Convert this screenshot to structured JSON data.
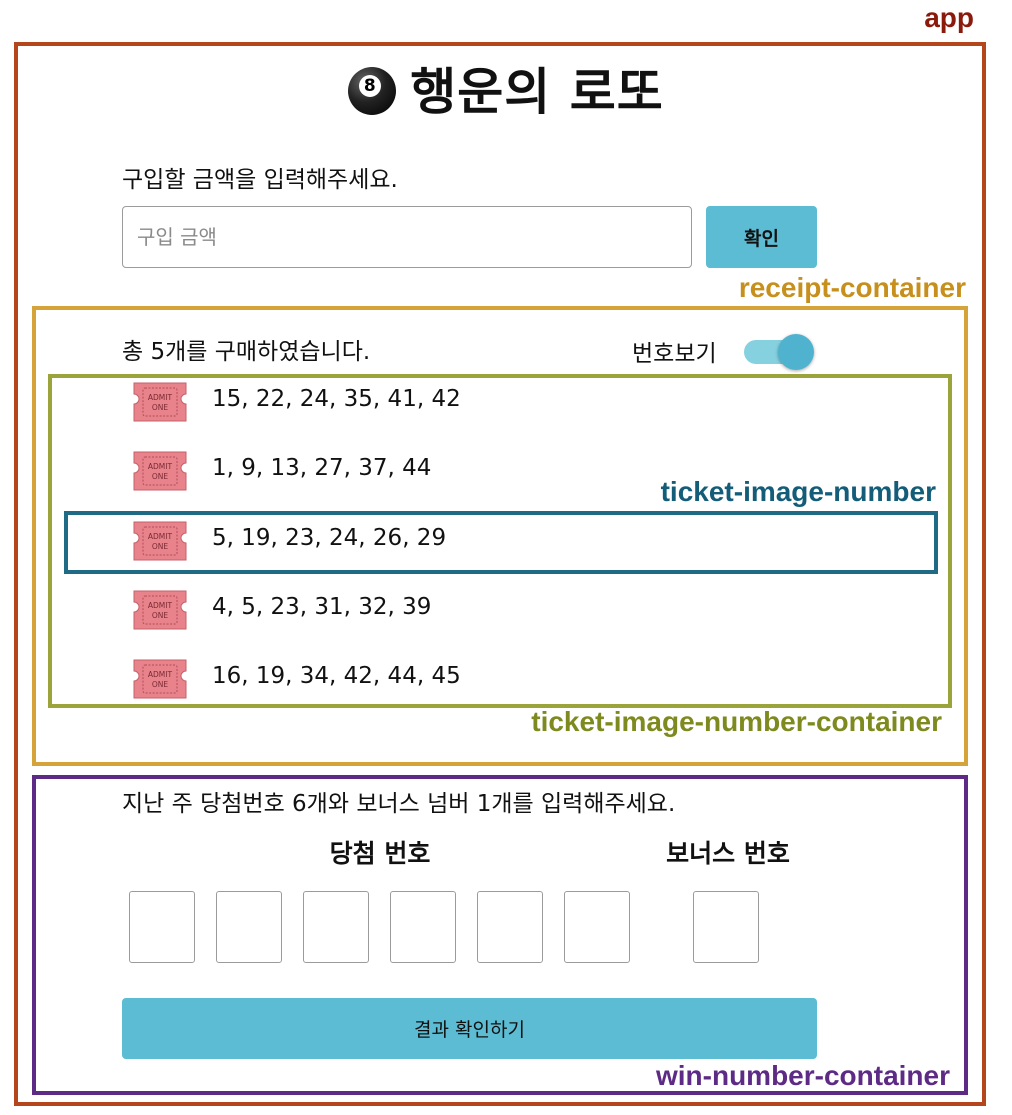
{
  "annotations": {
    "app": "app",
    "receipt_container": "receipt-container",
    "ticket_image_number": "ticket-image-number",
    "ticket_image_number_container": "ticket-image-number-container",
    "win_number_container": "win-number-container"
  },
  "header": {
    "icon": "8-ball-icon",
    "title": "행운의 로또"
  },
  "purchase": {
    "label": "구입할 금액을 입력해주세요.",
    "placeholder": "구입 금액",
    "value": "",
    "confirm_label": "확인"
  },
  "receipt": {
    "count_text": "총 5개를 구매하였습니다.",
    "toggle_label": "번호보기",
    "toggle_on": true,
    "ticket_icon": "admit-one-ticket-icon",
    "ticket_icon_text": [
      "ADMIT",
      "ONE"
    ],
    "tickets": [
      {
        "numbers": "15, 22, 24, 35, 41, 42"
      },
      {
        "numbers": "1, 9, 13, 27, 37, 44"
      },
      {
        "numbers": "5, 19, 23, 24, 26, 29"
      },
      {
        "numbers": "4, 5, 23, 31, 32, 39"
      },
      {
        "numbers": "16, 19, 34, 42, 44, 45"
      }
    ]
  },
  "win_numbers": {
    "description": "지난 주 당첨번호 6개와 보너스 넘버 1개를 입력해주세요.",
    "winning_heading": "당첨 번호",
    "bonus_heading": "보너스 번호",
    "winning_values": [
      "",
      "",
      "",
      "",
      "",
      ""
    ],
    "bonus_value": "",
    "result_button_label": "결과 확인하기"
  },
  "colors": {
    "accent": "#5bbcd3",
    "toggle_track": "#85d1e0",
    "ticket": "#e8838b",
    "app_frame": "#b5451b",
    "receipt_frame": "#d6a23a",
    "ticket_container_frame": "#9aa43a",
    "ticket_row_frame": "#1f6a84",
    "win_frame": "#5d2b86"
  }
}
